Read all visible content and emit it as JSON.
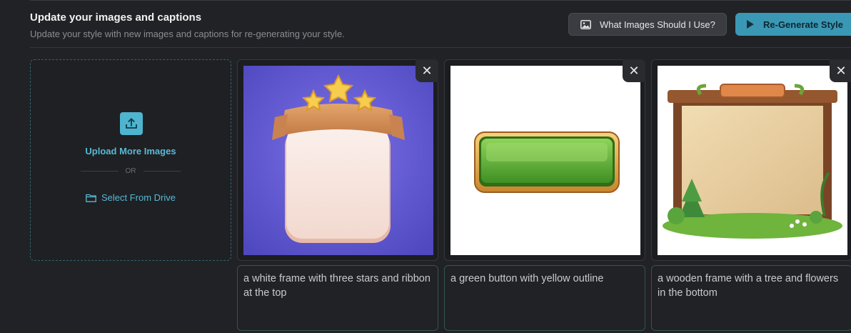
{
  "header": {
    "title": "Update your images and captions",
    "subtitle": "Update your style with new images and captions for re-generating your style.",
    "help_button": "What Images Should I Use?",
    "regen_button": "Re-Generate Style",
    "accent": "#3a98b5"
  },
  "upload": {
    "upload_label": "Upload More Images",
    "or_label": "OR",
    "drive_label": "Select From Drive",
    "icons": [
      "upload-icon",
      "folder-icon"
    ]
  },
  "images": [
    {
      "close": "✕",
      "caption": "a white frame with three stars and ribbon at the top"
    },
    {
      "close": "✕",
      "caption": "a green button with yellow outline"
    },
    {
      "close": "✕",
      "caption": "a wooden frame with a tree and flowers in the bottom"
    }
  ]
}
